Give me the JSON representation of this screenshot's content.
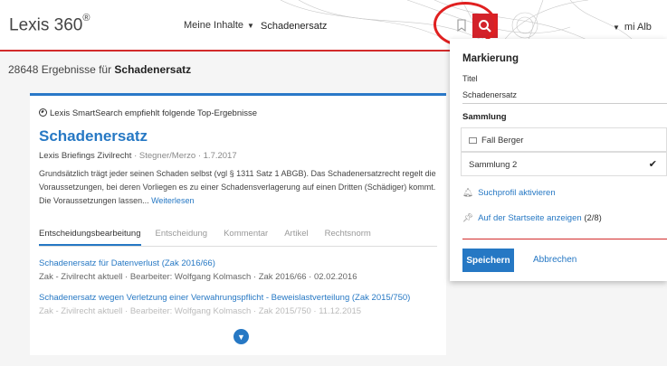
{
  "header": {
    "logo": "Lexis 360",
    "logo_mark": "®",
    "scope_label": "Meine Inhalte",
    "search_value": "Schadenersatz",
    "user_label": "mi Alb"
  },
  "results": {
    "count_prefix": "28648 Ergebnisse für",
    "query": "Schadenersatz"
  },
  "smartsearch": {
    "label": "Lexis SmartSearch empfiehlt folgende Top-Ergebnisse",
    "title": "Schadenersatz",
    "source": "Lexis Briefings Zivilrecht",
    "sep1": "·",
    "authors": "Stegner/Merzo",
    "sep2": "·",
    "date": "1.7.2017",
    "abstract": "Grundsätzlich trägt jeder seinen Schaden selbst (vgl § 1311 Satz 1 ABGB). Das Schadenersatzrecht regelt die Voraussetzungen, bei deren Vorliegen es zu einer Schadensverlagerung auf einen Dritten (Schädiger) kommt. Die Voraussetzungen lassen...",
    "read_more": "Weiterlesen",
    "tabs": [
      "Entscheidungsbearbeitung",
      "Entscheidung",
      "Kommentar",
      "Artikel",
      "Rechtsnorm"
    ],
    "items": [
      {
        "title": "Schadenersatz für Datenverlust (Zak 2016/66)",
        "meta": "Zak - Zivilrecht aktuell  ·  Bearbeiter: Wolfgang Kolmasch  ·  Zak 2016/66  ·  02.02.2016"
      },
      {
        "title": "Schadenersatz wegen Verletzung einer Verwahrungspflicht - Beweislastverteilung (Zak 2015/750)",
        "meta": "Zak - Zivilrecht aktuell  ·  Bearbeiter: Wolfgang Kolmasch  ·  Zak 2015/750  ·  11.12.2015"
      }
    ]
  },
  "panel": {
    "heading": "Markierung",
    "title_label": "Titel",
    "title_value": "Schadenersatz",
    "collection_heading": "Sammlung",
    "collections": [
      {
        "name": "Fall Berger"
      },
      {
        "name": "Sammlung 2",
        "check": "✔"
      }
    ],
    "search_profile": "Suchprofil aktivieren",
    "startpage_link": "Auf der Startseite anzeigen",
    "startpage_count": "(2/8)",
    "save": "Speichern",
    "cancel": "Abbrechen"
  },
  "colors": {
    "accent_blue": "#2678c4",
    "brand_red": "#d3222a",
    "highlight_circle": "#e02020"
  }
}
